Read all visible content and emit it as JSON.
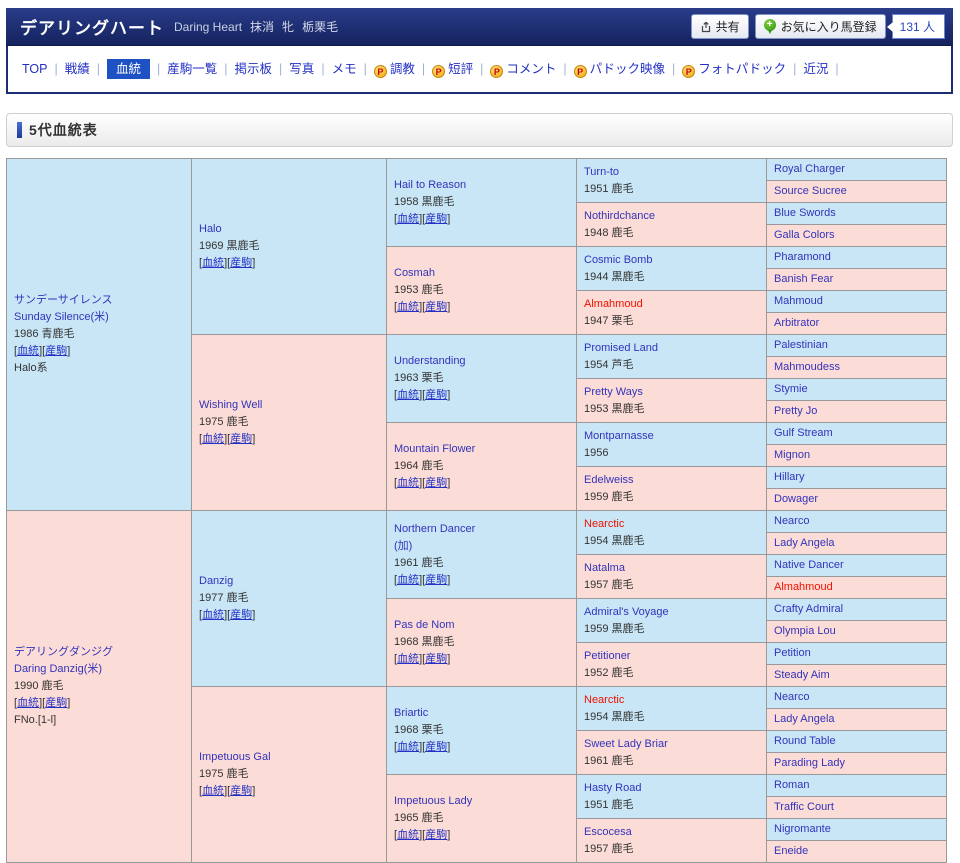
{
  "header": {
    "title": "デアリングハート",
    "title_en": "Daring Heart",
    "status": "抹消",
    "sex": "牝",
    "coat": "栃栗毛",
    "share_button": "共有",
    "favorite_button": "お気に入り馬登録",
    "favorite_count": "131 人"
  },
  "nav": {
    "separator": "|",
    "premium_icon": "P",
    "items": [
      {
        "label": "TOP",
        "premium": false,
        "active": false
      },
      {
        "label": "戦績",
        "premium": false,
        "active": false
      },
      {
        "label": "血統",
        "premium": false,
        "active": true
      },
      {
        "label": "産駒一覧",
        "premium": false,
        "active": false
      },
      {
        "label": "掲示板",
        "premium": false,
        "active": false
      },
      {
        "label": "写真",
        "premium": false,
        "active": false
      },
      {
        "label": "メモ",
        "premium": false,
        "active": false
      },
      {
        "label": "調教",
        "premium": true,
        "active": false
      },
      {
        "label": "短評",
        "premium": true,
        "active": false
      },
      {
        "label": "コメント",
        "premium": true,
        "active": false
      },
      {
        "label": "パドック映像",
        "premium": true,
        "active": false
      },
      {
        "label": "フォトパドック",
        "premium": true,
        "active": false
      },
      {
        "label": "近況",
        "premium": false,
        "active": false
      }
    ]
  },
  "section": {
    "title": "5代血統表"
  },
  "colors": {
    "male_bg": "#c8e6f6",
    "female_bg": "#fcdcd6",
    "link": "#3333bb",
    "inbreed_red": "#ee1100",
    "nav_active_bg": "#1d51c4",
    "header_bg": "#1a2a6b"
  },
  "pedigree": {
    "link_labels": {
      "blood": "血統",
      "offspring": "産駒"
    },
    "generations": [
      [
        {
          "name": "サンデーサイレンス",
          "sub": "Sunday Silence(米)",
          "info": "1986 青鹿毛",
          "links": true,
          "extra": "Halo系",
          "sex": "m"
        },
        {
          "name": "デアリングダンジグ",
          "sub": "Daring Danzig(米)",
          "info": "1990 鹿毛",
          "links": true,
          "extra": "FNo.[1-l]",
          "sex": "f"
        }
      ],
      [
        {
          "name": "Halo",
          "info": "1969 黒鹿毛",
          "links": true,
          "sex": "m"
        },
        {
          "name": "Wishing Well",
          "info": "1975 鹿毛",
          "links": true,
          "sex": "f"
        },
        {
          "name": "Danzig",
          "info": "1977 鹿毛",
          "links": true,
          "sex": "m"
        },
        {
          "name": "Impetuous Gal",
          "info": "1975 鹿毛",
          "links": true,
          "sex": "f"
        }
      ],
      [
        {
          "name": "Hail to Reason",
          "info": "1958 黒鹿毛",
          "links": true,
          "sex": "m"
        },
        {
          "name": "Cosmah",
          "info": "1953 鹿毛",
          "links": true,
          "sex": "f"
        },
        {
          "name": "Understanding",
          "info": "1963 栗毛",
          "links": true,
          "sex": "m"
        },
        {
          "name": "Mountain Flower",
          "info": "1964 鹿毛",
          "links": true,
          "sex": "f"
        },
        {
          "name": "Northern Dancer",
          "sub": "(加)",
          "info": "1961 鹿毛",
          "links": true,
          "sex": "m"
        },
        {
          "name": "Pas de Nom",
          "info": "1968 黒鹿毛",
          "links": true,
          "sex": "f"
        },
        {
          "name": "Briartic",
          "info": "1968 栗毛",
          "links": true,
          "sex": "m"
        },
        {
          "name": "Impetuous Lady",
          "info": "1965 鹿毛",
          "links": true,
          "sex": "f"
        }
      ],
      [
        {
          "name": "Turn-to",
          "info": "1951 鹿毛",
          "sex": "m"
        },
        {
          "name": "Nothirdchance",
          "info": "1948 鹿毛",
          "sex": "f"
        },
        {
          "name": "Cosmic Bomb",
          "info": "1944 黒鹿毛",
          "sex": "m"
        },
        {
          "name": "Almahmoud",
          "info": "1947 栗毛",
          "sex": "f",
          "red": true
        },
        {
          "name": "Promised Land",
          "info": "1954 芦毛",
          "sex": "m"
        },
        {
          "name": "Pretty Ways",
          "info": "1953 黒鹿毛",
          "sex": "f"
        },
        {
          "name": "Montparnasse",
          "info": "1956",
          "sex": "m"
        },
        {
          "name": "Edelweiss",
          "info": "1959 鹿毛",
          "sex": "f"
        },
        {
          "name": "Nearctic",
          "info": "1954 黒鹿毛",
          "sex": "m",
          "red": true
        },
        {
          "name": "Natalma",
          "info": "1957 鹿毛",
          "sex": "f"
        },
        {
          "name": "Admiral's Voyage",
          "info": "1959 黒鹿毛",
          "sex": "m"
        },
        {
          "name": "Petitioner",
          "info": "1952 鹿毛",
          "sex": "f"
        },
        {
          "name": "Nearctic",
          "info": "1954 黒鹿毛",
          "sex": "m",
          "red": true
        },
        {
          "name": "Sweet Lady Briar",
          "info": "1961 鹿毛",
          "sex": "f"
        },
        {
          "name": "Hasty Road",
          "info": "1951 鹿毛",
          "sex": "m"
        },
        {
          "name": "Escocesa",
          "info": "1957 鹿毛",
          "sex": "f"
        }
      ],
      [
        {
          "name": "Royal Charger",
          "sex": "m"
        },
        {
          "name": "Source Sucree",
          "sex": "f"
        },
        {
          "name": "Blue Swords",
          "sex": "m"
        },
        {
          "name": "Galla Colors",
          "sex": "f"
        },
        {
          "name": "Pharamond",
          "sex": "m"
        },
        {
          "name": "Banish Fear",
          "sex": "f"
        },
        {
          "name": "Mahmoud",
          "sex": "m"
        },
        {
          "name": "Arbitrator",
          "sex": "f"
        },
        {
          "name": "Palestinian",
          "sex": "m"
        },
        {
          "name": "Mahmoudess",
          "sex": "f"
        },
        {
          "name": "Stymie",
          "sex": "m"
        },
        {
          "name": "Pretty Jo",
          "sex": "f"
        },
        {
          "name": "Gulf Stream",
          "sex": "m"
        },
        {
          "name": "Mignon",
          "sex": "f"
        },
        {
          "name": "Hillary",
          "sex": "m"
        },
        {
          "name": "Dowager",
          "sex": "f"
        },
        {
          "name": "Nearco",
          "sex": "m"
        },
        {
          "name": "Lady Angela",
          "sex": "f"
        },
        {
          "name": "Native Dancer",
          "sex": "m"
        },
        {
          "name": "Almahmoud",
          "sex": "f",
          "red": true
        },
        {
          "name": "Crafty Admiral",
          "sex": "m"
        },
        {
          "name": "Olympia Lou",
          "sex": "f"
        },
        {
          "name": "Petition",
          "sex": "m"
        },
        {
          "name": "Steady Aim",
          "sex": "f"
        },
        {
          "name": "Nearco",
          "sex": "m"
        },
        {
          "name": "Lady Angela",
          "sex": "f"
        },
        {
          "name": "Round Table",
          "sex": "m"
        },
        {
          "name": "Parading Lady",
          "sex": "f"
        },
        {
          "name": "Roman",
          "sex": "m"
        },
        {
          "name": "Traffic Court",
          "sex": "f"
        },
        {
          "name": "Nigromante",
          "sex": "m"
        },
        {
          "name": "Eneide",
          "sex": "f"
        }
      ]
    ]
  }
}
